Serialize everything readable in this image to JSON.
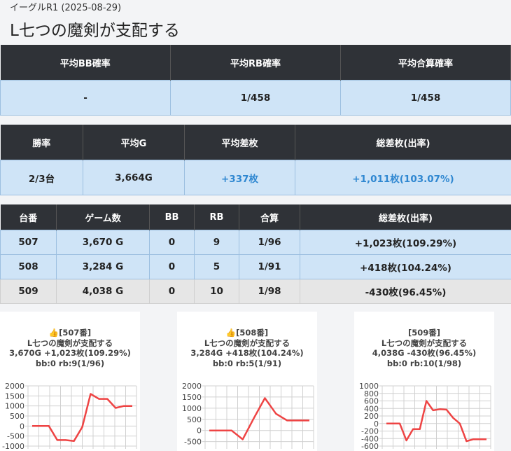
{
  "header": {
    "subtitle": "イーグルR1 (2025-08-29)",
    "title": "L七つの魔剣が支配する"
  },
  "prob_table": {
    "headers": [
      "平均BB確率",
      "平均RB確率",
      "平均合算確率"
    ],
    "row": [
      "-",
      "1/458",
      "1/458"
    ]
  },
  "summary_table": {
    "headers": [
      "勝率",
      "平均G",
      "平均差枚",
      "総差枚(出率)"
    ],
    "row": [
      "2/3台",
      "3,664G",
      "+337枚",
      "+1,011枚(103.07%)"
    ]
  },
  "machine_table": {
    "headers": [
      "台番",
      "ゲーム数",
      "BB",
      "RB",
      "合算",
      "総差枚(出率)"
    ],
    "rows": [
      [
        "507",
        "3,670 G",
        "0",
        "9",
        "1/96",
        "+1,023枚(109.29%)"
      ],
      [
        "508",
        "3,284 G",
        "0",
        "5",
        "1/91",
        "+418枚(104.24%)"
      ],
      [
        "509",
        "4,038 G",
        "0",
        "10",
        "1/98",
        "-430枚(96.45%)"
      ]
    ]
  },
  "cards": [
    {
      "line1": "👍[507番]",
      "line2": "L七つの魔剣が支配する",
      "line3": "3,670G +1,023枚(109.29%)",
      "line4": "bb:0 rb:9(1/96)",
      "chart_data": {
        "type": "line",
        "ylim": [
          -1000,
          2000
        ],
        "ticks": [
          "2000",
          "1500",
          "1000",
          "500",
          "0",
          "-500",
          "-1000"
        ],
        "tick_values": [
          2000,
          1500,
          1000,
          500,
          0,
          -500,
          -1000
        ],
        "values": [
          0,
          0,
          0,
          -700,
          -700,
          -750,
          -50,
          1600,
          1350,
          1350,
          900,
          1000,
          1000
        ],
        "color": "#ee4444"
      }
    },
    {
      "line1": "👍[508番]",
      "line2": "L七つの魔剣が支配する",
      "line3": "3,284G +418枚(104.24%)",
      "line4": "bb:0 rb:5(1/91)",
      "chart_data": {
        "type": "line",
        "ylim": [
          -700,
          2000
        ],
        "ticks": [
          "2000",
          "1500",
          "1000",
          "500",
          "0",
          "-500"
        ],
        "tick_values": [
          2000,
          1500,
          1000,
          500,
          0,
          -500
        ],
        "values": [
          0,
          0,
          0,
          -400,
          550,
          1450,
          750,
          450,
          450,
          450
        ],
        "color": "#ee4444"
      }
    },
    {
      "line1": "[509番]",
      "line2": "L七つの魔剣が支配する",
      "line3": "4,038G -430枚(96.45%)",
      "line4": "bb:0 rb:10(1/98)",
      "chart_data": {
        "type": "line",
        "ylim": [
          -600,
          1000
        ],
        "ticks": [
          "1000",
          "800",
          "600",
          "400",
          "200",
          "0",
          "-200",
          "-400",
          "-600"
        ],
        "tick_values": [
          1000,
          800,
          600,
          400,
          200,
          0,
          -200,
          -400,
          -600
        ],
        "values": [
          0,
          0,
          0,
          -450,
          -150,
          -150,
          600,
          350,
          380,
          370,
          150,
          0,
          -470,
          -420,
          -420,
          -420
        ],
        "color": "#ee4444"
      }
    }
  ]
}
